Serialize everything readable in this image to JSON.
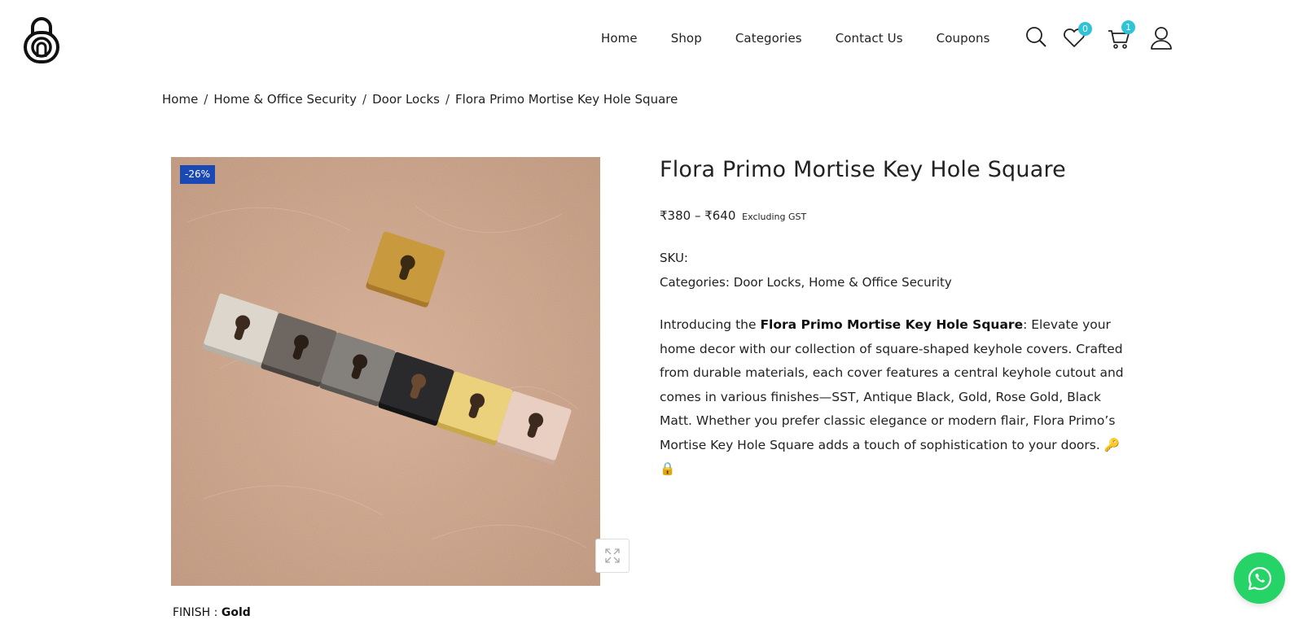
{
  "nav": {
    "items": [
      "Home",
      "Shop",
      "Categories",
      "Contact Us",
      "Coupons"
    ]
  },
  "header_icons": {
    "search": "search-icon",
    "wishlist": "heart-icon",
    "wishlist_count": "0",
    "cart": "cart-icon",
    "cart_count": "1",
    "account": "user-icon"
  },
  "breadcrumb": {
    "items": [
      "Home",
      "Home & Office Security",
      "Door Locks",
      "Flora Primo Mortise Key Hole Square"
    ],
    "separator": "/"
  },
  "product": {
    "sale_badge": "-26%",
    "title": "Flora Primo Mortise Key Hole Square",
    "price_range": "₹380 – ₹640",
    "price_note": "Excluding GST",
    "sku_label": "SKU:",
    "categories_label": "Categories:",
    "categories": [
      "Door Locks",
      "Home & Office Security"
    ],
    "desc_intro": "Introducing the ",
    "desc_bold": "Flora Primo Mortise Key Hole Square",
    "desc_rest": ": Elevate your home decor with our collection of square-shaped keyhole covers. Crafted from durable materials, each cover features a central keyhole cutout and comes in various finishes—SST, Antique Black, Gold, Rose Gold, Black Matt. Whether you prefer classic elegance or modern flair, Flora Primo’s Mortise Key Hole Square adds a touch of sophistication to your doors. 🔑 🔒",
    "finish_label": "FINISH : ",
    "finish_value": "Gold"
  },
  "colors": {
    "badge_accent": "#2ec4d6",
    "sale_badge": "#1a49b5",
    "whatsapp": "#25d366"
  }
}
